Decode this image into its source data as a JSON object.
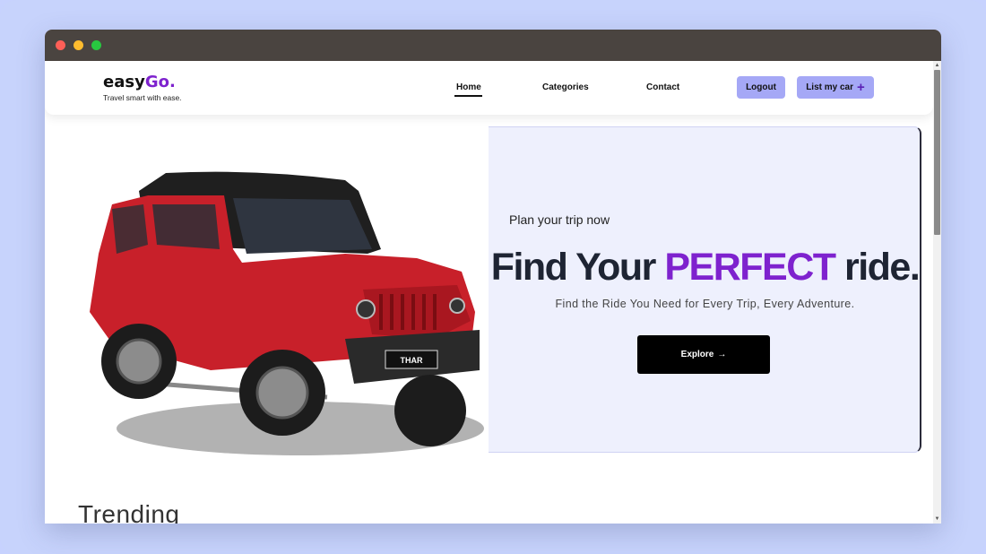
{
  "brand": {
    "name_main": "easy",
    "name_accent": "Go.",
    "tagline": "Travel smart with ease."
  },
  "nav": {
    "home": "Home",
    "categories": "Categories",
    "contact": "Contact",
    "logout": "Logout",
    "list_car": "List my car",
    "plus_icon": "+"
  },
  "hero": {
    "eyebrow": "Plan your trip now",
    "headline_pre": "Find Your ",
    "headline_accent": "PERFECT",
    "headline_post": " ride.",
    "subline": "Find the Ride You Need for Every Trip, Every Adventure.",
    "explore": "Explore",
    "arrow_icon": "→",
    "car_badge": "THAR"
  },
  "sections": {
    "trending": "Trending"
  },
  "colors": {
    "accent": "#7e22ce",
    "button": "#a5a8f6",
    "panel": "#eef0fd",
    "car": "#c8202a"
  }
}
